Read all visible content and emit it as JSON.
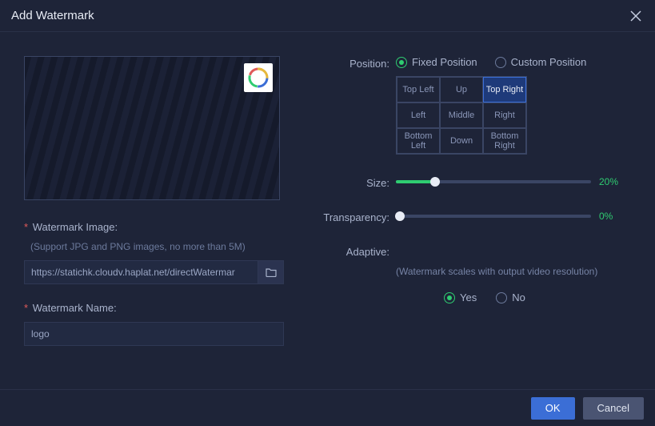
{
  "title": "Add Watermark",
  "left": {
    "image_label": "Watermark Image",
    "image_hint": "(Support JPG and PNG images, no more than 5M)",
    "image_value": "https://statichk.cloudv.haplat.net/directWatermar",
    "name_label": "Watermark Name",
    "name_value": "logo"
  },
  "position": {
    "label": "Position",
    "fixed_label": "Fixed Position",
    "custom_label": "Custom Position",
    "mode": "fixed",
    "cells": [
      "Top Left",
      "Up",
      "Top Right",
      "Left",
      "Middle",
      "Right",
      "Bottom Left",
      "Down",
      "Bottom Right"
    ],
    "selected": "Top Right"
  },
  "size": {
    "label": "Size",
    "value": 20,
    "display": "20%"
  },
  "transparency": {
    "label": "Transparency",
    "value": 0,
    "display": "0%"
  },
  "adaptive": {
    "label": "Adaptive",
    "hint": "(Watermark scales with output video resolution)",
    "yes": "Yes",
    "no": "No",
    "value": "yes"
  },
  "footer": {
    "ok": "OK",
    "cancel": "Cancel"
  },
  "colon": ":"
}
